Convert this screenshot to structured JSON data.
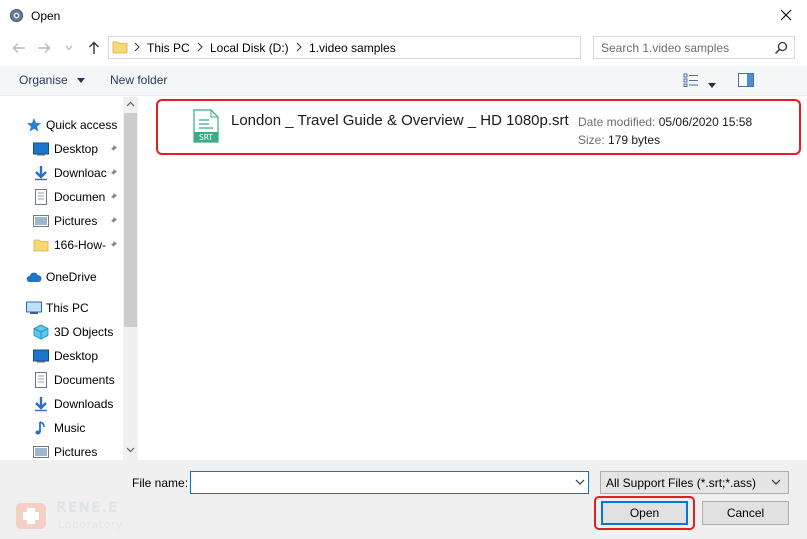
{
  "window": {
    "title": "Open"
  },
  "address": {
    "crumbs": [
      "This PC",
      "Local Disk (D:)",
      "1.video samples"
    ]
  },
  "search": {
    "placeholder": "Search 1.video samples"
  },
  "toolbar": {
    "organise_label": "Organise",
    "new_folder_label": "New folder"
  },
  "sidebar": {
    "items": [
      {
        "label": "Quick access",
        "icon": "star-icon",
        "pinned": false
      },
      {
        "label": "Desktop",
        "icon": "desktop-icon",
        "pinned": true
      },
      {
        "label": "Downloac",
        "icon": "download-icon",
        "pinned": true
      },
      {
        "label": "Documen",
        "icon": "documents-icon",
        "pinned": true
      },
      {
        "label": "Pictures",
        "icon": "pictures-icon",
        "pinned": true
      },
      {
        "label": "166-How-",
        "icon": "folder-icon",
        "pinned": true
      },
      {
        "label": "OneDrive",
        "icon": "cloud-icon",
        "pinned": false
      },
      {
        "label": "This PC",
        "icon": "computer-icon",
        "pinned": false
      },
      {
        "label": "3D Objects",
        "icon": "cube-icon",
        "pinned": false
      },
      {
        "label": "Desktop",
        "icon": "desktop-icon",
        "pinned": false
      },
      {
        "label": "Documents",
        "icon": "documents-icon",
        "pinned": false
      },
      {
        "label": "Downloads",
        "icon": "download-icon",
        "pinned": false
      },
      {
        "label": "Music",
        "icon": "music-icon",
        "pinned": false
      },
      {
        "label": "Pictures",
        "icon": "pictures-icon",
        "pinned": false
      }
    ]
  },
  "file": {
    "name": "London _ Travel Guide & Overview _ HD 1080p.srt",
    "icon_label": "SRT",
    "date_label": "Date modified:",
    "date_value": "05/06/2020 15:58",
    "size_label": "Size:",
    "size_value": "179 bytes"
  },
  "bottom": {
    "file_name_label": "File name:",
    "file_name_value": "",
    "filter_label": "All Support Files (*.srt;*.ass)",
    "open_label": "Open",
    "cancel_label": "Cancel"
  },
  "watermark": {
    "line1": "RENE.E",
    "line2": "Laboratory"
  },
  "colors": {
    "accent": "#0078d7",
    "highlight": "#e02020",
    "srt_green": "#3aae82"
  }
}
